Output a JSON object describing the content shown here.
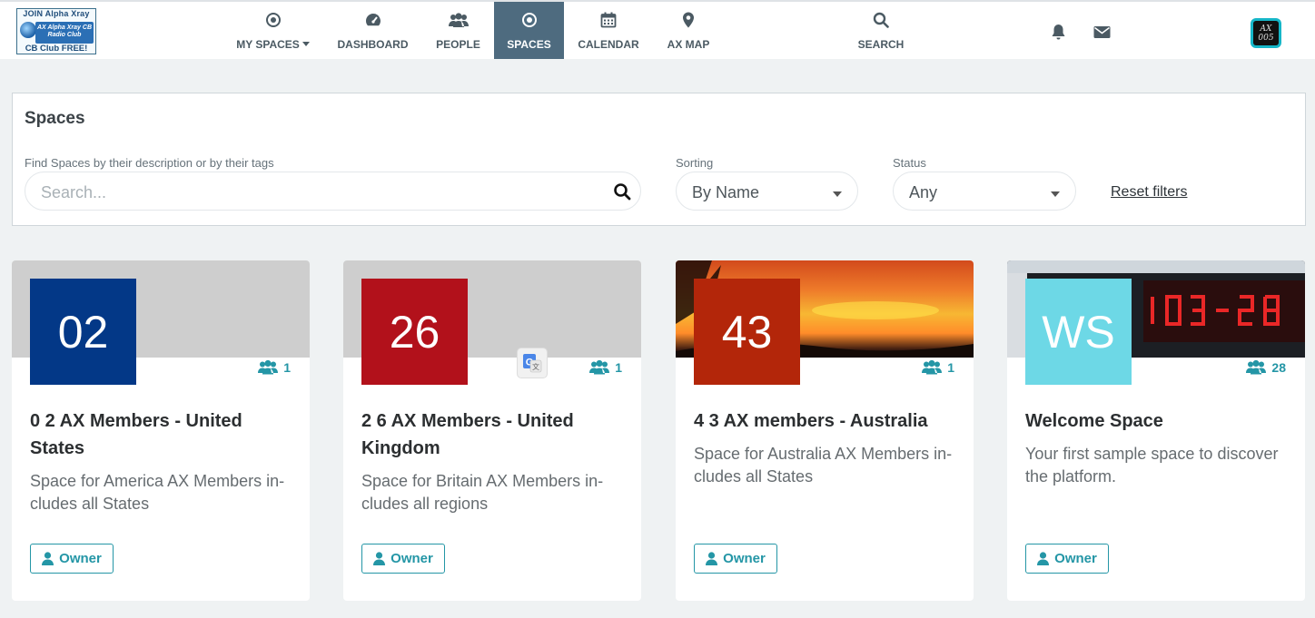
{
  "logo": {
    "line1": "JOIN Alpha Xray",
    "line2": "AX Alpha Xray CB Radio Club",
    "line3": "CB Club FREE!"
  },
  "nav": {
    "items": [
      {
        "label": "MY SPACES",
        "icon": "target-icon"
      },
      {
        "label": "DASHBOARD",
        "icon": "speedometer-icon"
      },
      {
        "label": "PEOPLE",
        "icon": "users-icon"
      },
      {
        "label": "SPACES",
        "icon": "target-icon",
        "active": true
      },
      {
        "label": "CALENDAR",
        "icon": "calendar-icon"
      },
      {
        "label": "AX MAP",
        "icon": "map-marker-icon"
      },
      {
        "label": "SEARCH",
        "icon": "search-icon"
      }
    ],
    "avatar_text": "AX 005"
  },
  "filters": {
    "title": "Spaces",
    "search_label": "Find Spaces by their description or by their tags",
    "search_placeholder": "Search...",
    "sorting_label": "Sorting",
    "sorting_value": "By Name",
    "status_label": "Status",
    "status_value": "Any",
    "reset_label": "Reset filters"
  },
  "cards": [
    {
      "tile": "02",
      "tile_color": "#033887",
      "members": "1",
      "title": "0 2 AX Members - United States",
      "desc": "Space for America AX Members in-cludes all States",
      "owner": "Owner"
    },
    {
      "tile": "26",
      "tile_color": "#b2111b",
      "members": "1",
      "title": "2 6 AX Members - United Kingdom",
      "desc": "Space for Britain AX Members in-cludes all regions",
      "owner": "Owner"
    },
    {
      "tile": "43",
      "tile_color": "#b3260a",
      "members": "1",
      "title": "4 3 AX members - Australia",
      "desc": "Space for Australia AX Members in-cludes all States",
      "owner": "Owner"
    },
    {
      "tile": "WS",
      "tile_color": "#6dd8e6",
      "members": "28",
      "title": "Welcome Space",
      "desc": "Your first sample space to discover the platform.",
      "owner": "Owner"
    }
  ],
  "colors": {
    "accent": "#2496a6",
    "nav_active": "#4e6b7f"
  }
}
